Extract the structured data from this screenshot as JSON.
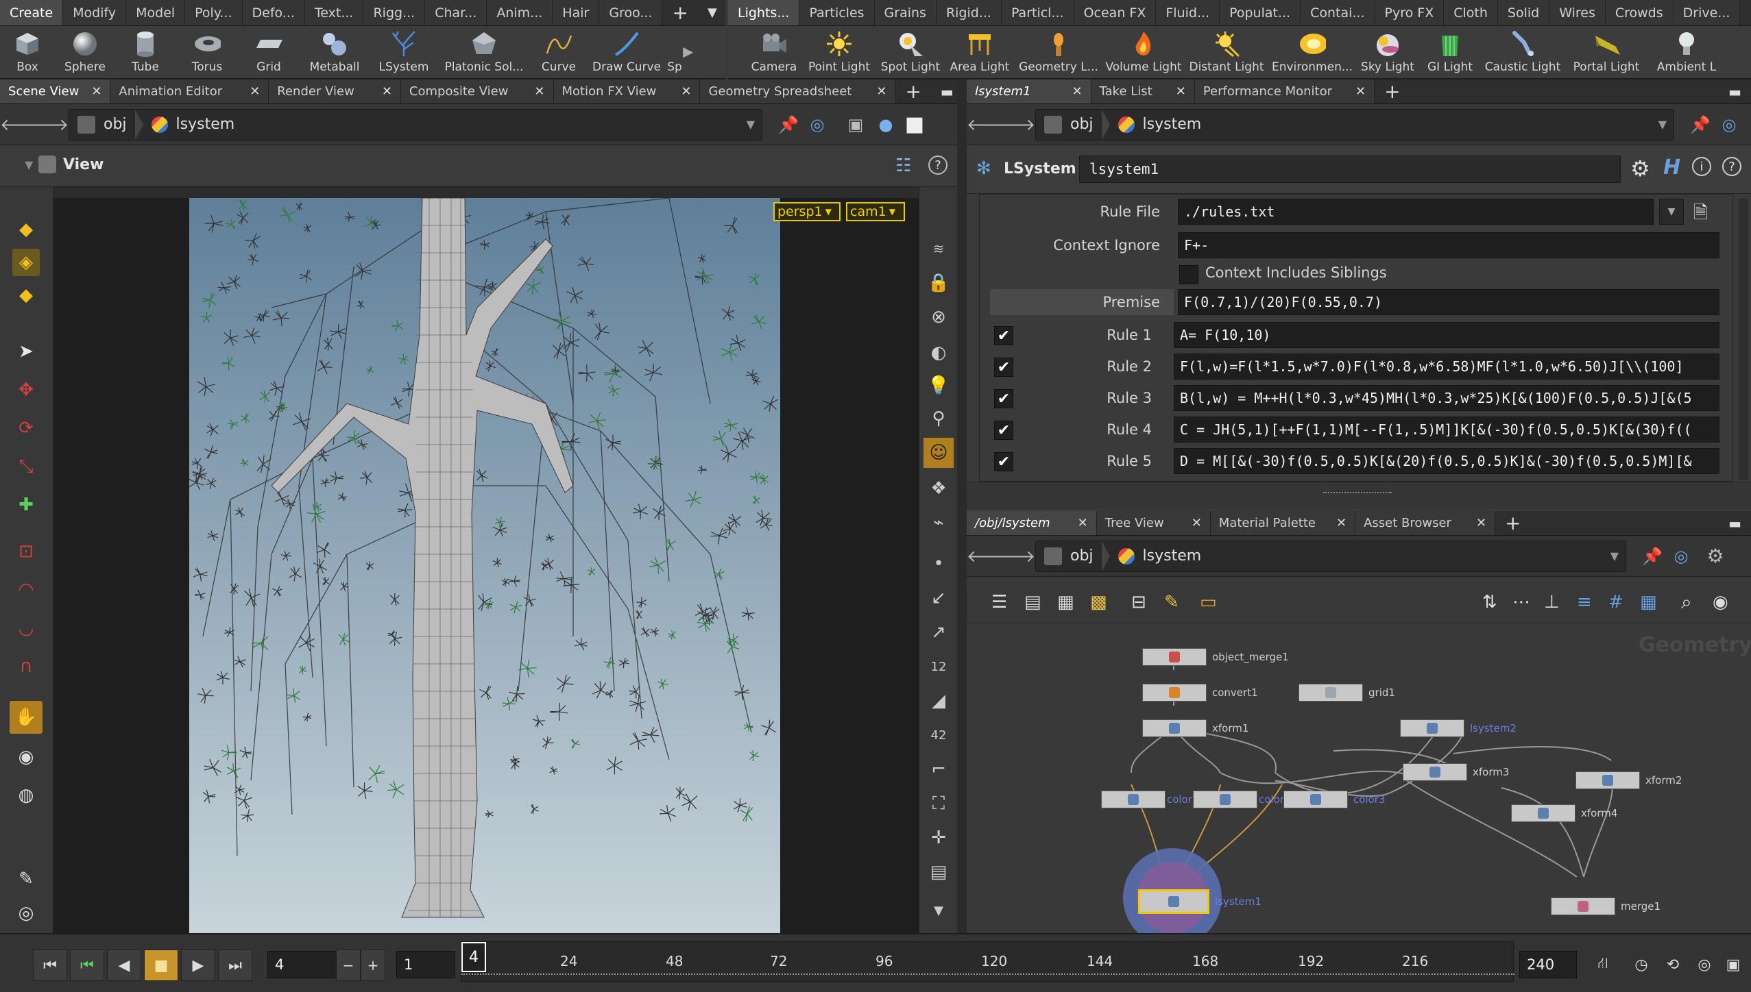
{
  "shelf_left": {
    "tabs": [
      "Create",
      "Modify",
      "Model",
      "Poly...",
      "Defo...",
      "Text...",
      "Rigg...",
      "Char...",
      "Anim...",
      "Hair",
      "Groo..."
    ],
    "tools": [
      {
        "label": "Box",
        "icon": "box-icon"
      },
      {
        "label": "Sphere",
        "icon": "sphere-icon"
      },
      {
        "label": "Tube",
        "icon": "tube-icon"
      },
      {
        "label": "Torus",
        "icon": "torus-icon"
      },
      {
        "label": "Grid",
        "icon": "grid-icon"
      },
      {
        "label": "Metaball",
        "icon": "metaball-icon"
      },
      {
        "label": "LSystem",
        "icon": "lsystem-icon"
      },
      {
        "label": "Platonic Sol...",
        "icon": "platonic-icon"
      },
      {
        "label": "Curve",
        "icon": "curve-icon"
      },
      {
        "label": "Draw Curve",
        "icon": "draw-curve-icon"
      },
      {
        "label": "Sp",
        "icon": "spray-icon"
      }
    ]
  },
  "shelf_right": {
    "tabs": [
      "Lights...",
      "Particles",
      "Grains",
      "Rigid...",
      "Particl...",
      "Ocean FX",
      "Fluid...",
      "Populat...",
      "Contai...",
      "Pyro FX",
      "Cloth",
      "Solid",
      "Wires",
      "Crowds",
      "Drive..."
    ],
    "tools": [
      {
        "label": "Camera",
        "icon": "camera-icon"
      },
      {
        "label": "Point Light",
        "icon": "point-light-icon"
      },
      {
        "label": "Spot Light",
        "icon": "spot-light-icon"
      },
      {
        "label": "Area Light",
        "icon": "area-light-icon"
      },
      {
        "label": "Geometry L...",
        "icon": "geometry-light-icon"
      },
      {
        "label": "Volume Light",
        "icon": "volume-light-icon"
      },
      {
        "label": "Distant Light",
        "icon": "distant-light-icon"
      },
      {
        "label": "Environmen...",
        "icon": "environment-light-icon"
      },
      {
        "label": "Sky Light",
        "icon": "sky-light-icon"
      },
      {
        "label": "GI Light",
        "icon": "gi-light-icon"
      },
      {
        "label": "Caustic Light",
        "icon": "caustic-light-icon"
      },
      {
        "label": "Portal Light",
        "icon": "portal-light-icon"
      },
      {
        "label": "Ambient L",
        "icon": "ambient-light-icon"
      }
    ]
  },
  "left_pane": {
    "tabs": [
      "Scene View",
      "Animation Editor",
      "Render View",
      "Composite View",
      "Motion FX View",
      "Geometry Spreadsheet"
    ],
    "path": {
      "root": "obj",
      "node": "lsystem"
    },
    "view_label": "View",
    "camera_menu": "persp1",
    "cam_menu": "cam1"
  },
  "param_pane": {
    "tabs": [
      "lsystem1",
      "Take List",
      "Performance Monitor"
    ],
    "path": {
      "root": "obj",
      "node": "lsystem"
    },
    "node_type": "LSystem",
    "node_name": "lsystem1",
    "rule_file_label": "Rule File",
    "rule_file": "./rules.txt",
    "context_ignore_label": "Context Ignore",
    "context_ignore": "F+-",
    "context_siblings_label": "Context Includes Siblings",
    "premise_label": "Premise",
    "premise": "F(0.7,1)/(20)F(0.55,0.7)",
    "rules": [
      {
        "label": "Rule 1",
        "value": "A= F(10,10)"
      },
      {
        "label": "Rule 2",
        "value": "F(l,w)=F(l*1.5,w*7.0)F(l*0.8,w*6.58)MF(l*1.0,w*6.50)J[\\\\(100]"
      },
      {
        "label": "Rule 3",
        "value": "B(l,w) = M++H(l*0.3,w*45)MH(l*0.3,w*25)K[&(100)F(0.5,0.5)J[&(5"
      },
      {
        "label": "Rule 4",
        "value": "C = JH(5,1)[++F(1,1)M[--F(1,.5)M]]K[&(-30)f(0.5,0.5)K[&(30)f(("
      },
      {
        "label": "Rule 5",
        "value": "D = M[[&(-30)f(0.5,0.5)K[&(20)f(0.5,0.5)K]&(-30)f(0.5,0.5)M][&"
      }
    ]
  },
  "network_pane": {
    "tabs": [
      "/obj/lsystem",
      "Tree View",
      "Material Palette",
      "Asset Browser"
    ],
    "path": {
      "root": "obj",
      "node": "lsystem"
    },
    "context_label": "Geometry",
    "nodes": [
      {
        "name": "object_merge1",
        "color": "#c94e4e"
      },
      {
        "name": "convert1",
        "color": "#d6842a"
      },
      {
        "name": "grid1",
        "color": "#9aa5ad"
      },
      {
        "name": "xform1",
        "color": "#5a7fb0"
      },
      {
        "name": "lsystem2",
        "color": "#5a7fb0"
      },
      {
        "name": "xform3",
        "color": "#5a7fb0"
      },
      {
        "name": "xform2",
        "color": "#5a7fb0"
      },
      {
        "name": "color1",
        "color": "#5a7fb0"
      },
      {
        "name": "color2",
        "color": "#5a7fb0"
      },
      {
        "name": "color3",
        "color": "#5a7fb0"
      },
      {
        "name": "xform4",
        "color": "#5a7fb0"
      },
      {
        "name": "lsystem1",
        "color": "#5a7fb0"
      },
      {
        "name": "merge1",
        "color": "#c06080"
      }
    ]
  },
  "timeline": {
    "current_frame": "4",
    "frame_field": "4",
    "step_field": "1",
    "end_frame": "240",
    "ticks": [
      "24",
      "48",
      "72",
      "96",
      "120",
      "144",
      "168",
      "192",
      "216"
    ]
  },
  "colors": {
    "accent": "#f0b400",
    "viewport_top": "#5f7f99",
    "viewport_bottom": "#c8d4da",
    "node_selected": "#f0c800"
  }
}
